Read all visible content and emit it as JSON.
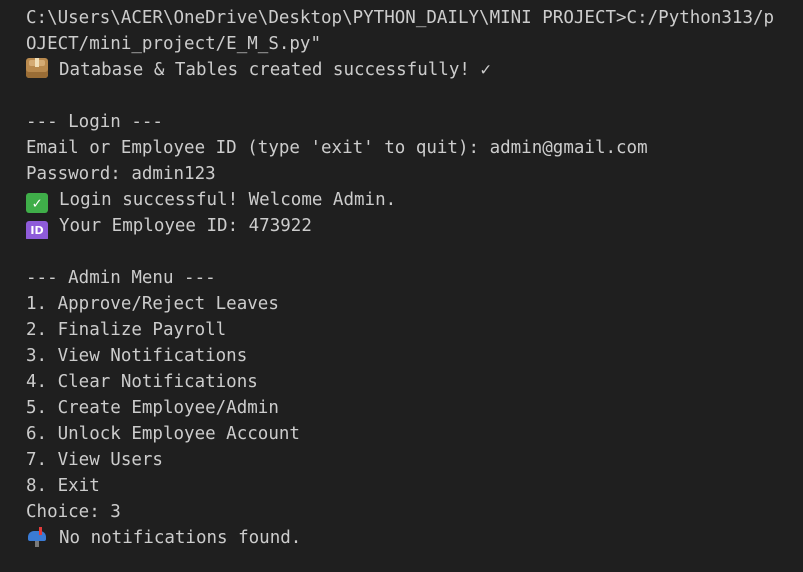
{
  "terminal": {
    "lines": {
      "cmd_1": "C:\\Users\\ACER\\OneDrive\\Desktop\\PYTHON_DAILY\\MINI PROJECT>C:/Python313/p",
      "cmd_2": "OJECT/mini_project/E_M_S.py\"",
      "db_created": "Database & Tables created successfully! ✓",
      "login_header": "--- Login ---",
      "email_prompt": "Email or Employee ID (type 'exit' to quit): admin@gmail.com",
      "password_prompt": "Password: admin123",
      "login_success": "Login successful! Welcome Admin.",
      "employee_id": "Your Employee ID: 473922",
      "menu_header": "--- Admin Menu ---",
      "menu_items": [
        "1. Approve/Reject Leaves",
        "2. Finalize Payroll",
        "3. View Notifications",
        "4. Clear Notifications",
        "5. Create Employee/Admin",
        "6. Unlock Employee Account",
        "7. View Users",
        "8. Exit"
      ],
      "choice": "Choice: 3",
      "no_notifications": "No notifications found."
    },
    "icons": {
      "db_created": "package-icon",
      "login_success": "check-mark-icon",
      "employee_id": "id-badge-icon",
      "no_notifications": "mailbox-icon"
    },
    "id_badge_text": "ID",
    "check_glyph": "✓"
  }
}
